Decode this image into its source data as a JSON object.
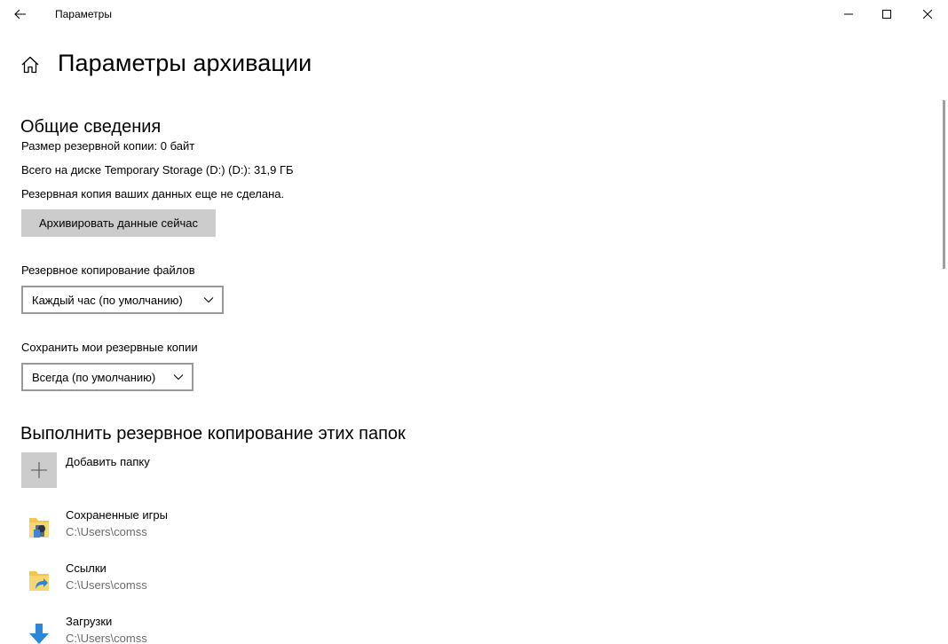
{
  "window": {
    "app_title": "Параметры"
  },
  "header": {
    "title": "Параметры архивации"
  },
  "overview": {
    "heading": "Общие сведения",
    "backup_size": "Размер резервной копии: 0 байт",
    "disk_total": "Всего на диске Temporary Storage (D:) (D:): 31,9 ГБ",
    "status": "Резервная копия ваших данных еще не сделана.",
    "backup_now_label": "Архивировать данные сейчас"
  },
  "backup_frequency": {
    "label": "Резервное копирование файлов",
    "selected": "Каждый час (по умолчанию)"
  },
  "keep_backups": {
    "label": "Сохранить мои резервные копии",
    "selected": "Всегда (по умолчанию)"
  },
  "folders": {
    "heading": "Выполнить резервное копирование этих папок",
    "add_label": "Добавить папку",
    "items": [
      {
        "name": "Сохраненные игры",
        "path": "C:\\Users\\comss",
        "icon": "saved-games-folder-icon"
      },
      {
        "name": "Ссылки",
        "path": "C:\\Users\\comss",
        "icon": "links-folder-icon"
      },
      {
        "name": "Загрузки",
        "path": "C:\\Users\\comss",
        "icon": "downloads-folder-icon"
      }
    ]
  },
  "colors": {
    "button_bg": "#cccccc",
    "dropdown_border": "#999999",
    "secondary_text": "#6b6b6b",
    "folder_yellow": "#f3c54c",
    "download_blue": "#2b88d8"
  }
}
